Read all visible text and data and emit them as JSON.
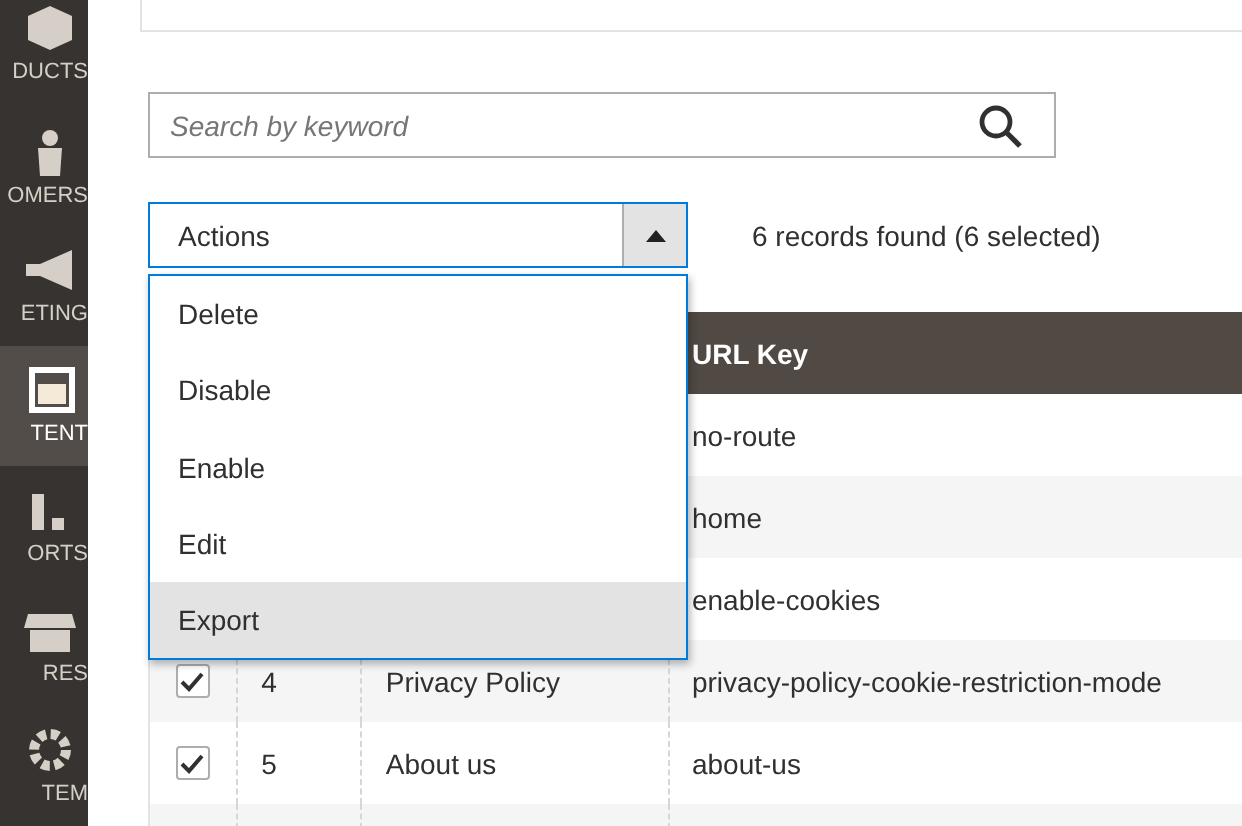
{
  "sidebar": {
    "items": [
      {
        "label": "DUCTS",
        "selected": false
      },
      {
        "label": "OMERS",
        "selected": false
      },
      {
        "label": "ETING",
        "selected": false
      },
      {
        "label": "TENT",
        "selected": true
      },
      {
        "label": "ORTS",
        "selected": false
      },
      {
        "label": "RES",
        "selected": false
      },
      {
        "label": "TEM",
        "selected": false
      }
    ]
  },
  "search": {
    "placeholder": "Search by keyword"
  },
  "actions": {
    "label": "Actions",
    "expanded": true,
    "options": [
      {
        "label": "Delete",
        "selected": false
      },
      {
        "label": "Disable",
        "selected": false
      },
      {
        "label": "Enable",
        "selected": false
      },
      {
        "label": "Edit",
        "selected": false
      },
      {
        "label": "Export",
        "selected": true
      }
    ]
  },
  "records": "6 records found (6 selected)",
  "table": {
    "columns": [
      "URL Key"
    ],
    "rows": [
      {
        "url_key": "no-route"
      },
      {
        "url_key": "home"
      },
      {
        "url_key": "enable-cookies"
      },
      {
        "checked": true,
        "id": "4",
        "title": "Privacy Policy",
        "url_key": "privacy-policy-cookie-restriction-mode"
      },
      {
        "checked": true,
        "id": "5",
        "title": "About us",
        "url_key": "about-us"
      },
      {}
    ]
  }
}
